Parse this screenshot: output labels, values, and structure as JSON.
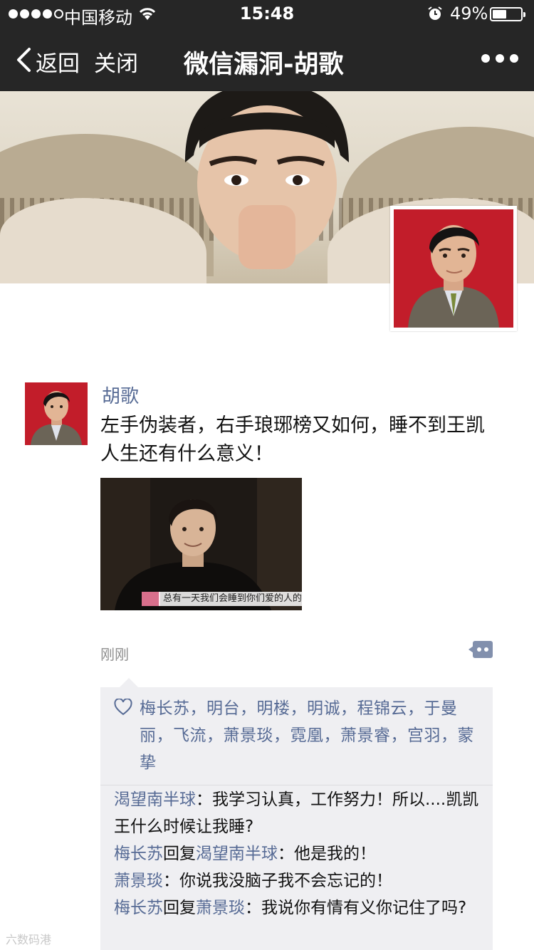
{
  "status_bar": {
    "carrier": "中国移动",
    "time": "15:48",
    "battery_percent": "49%",
    "battery_level": 0.49
  },
  "nav": {
    "back_label": "返回",
    "close_label": "关闭",
    "title": "微信漏洞-胡歌"
  },
  "post": {
    "author": "胡歌",
    "text": "左手伪装者，右手琅琊榜又如何，睡不到王凯人生还有什么意义！",
    "image_caption": "总有一天我们会睡到你们爱的人的",
    "time": "刚刚"
  },
  "likes": {
    "names": [
      "梅长苏",
      "明台",
      "明楼",
      "明诚",
      "程锦云",
      "于曼丽",
      "飞流",
      "萧景琰",
      "霓凰",
      "萧景睿",
      "宫羽",
      "蒙挚"
    ]
  },
  "comments": [
    {
      "author": "渴望南半球",
      "reply_word": "",
      "reply_to": "",
      "text": "我学习认真，工作努力！所以....凯凯王什么时候让我睡?"
    },
    {
      "author": "梅长苏",
      "reply_word": "回复",
      "reply_to": "渴望南半球",
      "text": "他是我的！"
    },
    {
      "author": "萧景琰",
      "reply_word": "",
      "reply_to": "",
      "text": "你说我没脑子我不会忘记的！"
    },
    {
      "author": "梅长苏",
      "reply_word": "回复",
      "reply_to": "萧景琰",
      "text": "我说你有情有义你记住了吗?"
    }
  ],
  "watermark": "六数码港",
  "colors": {
    "link": "#576b95",
    "topbar": "#262626",
    "social_bg": "#efeff2"
  }
}
